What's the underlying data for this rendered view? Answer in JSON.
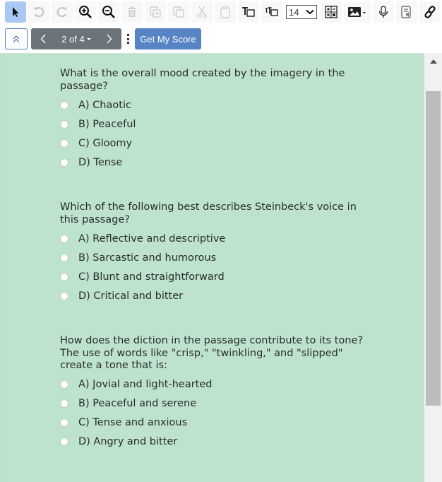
{
  "toolbar": {
    "items": [
      {
        "icon": "pointer-icon",
        "active": true,
        "enabled": true
      },
      {
        "icon": "undo-icon",
        "enabled": false
      },
      {
        "icon": "redo-icon",
        "enabled": false
      },
      {
        "icon": "zoom-in-icon",
        "enabled": true
      },
      {
        "icon": "zoom-out-icon",
        "enabled": true
      },
      {
        "icon": "trash-icon",
        "enabled": false
      },
      {
        "icon": "paste-special-icon",
        "enabled": false
      },
      {
        "icon": "copy-icon",
        "enabled": false
      },
      {
        "icon": "cut-icon",
        "enabled": false
      },
      {
        "icon": "clipboard-icon",
        "enabled": false
      },
      {
        "icon": "text-box-icon",
        "enabled": true
      },
      {
        "icon": "text-size-icon",
        "enabled": true
      }
    ],
    "font_size": "14",
    "extra": [
      "calculator-icon",
      "image-icon",
      "microphone-icon",
      "text-to-speech-icon",
      "link-icon"
    ]
  },
  "nav": {
    "page_label": "2 of 4",
    "score_button": "Get My Score",
    "colors": {
      "pager": "#6c747b",
      "score": "#5684c4",
      "content_bg": "#bde3cd"
    }
  },
  "questions": [
    {
      "text": "What is the overall mood created by the imagery in the passage?",
      "options": [
        "A) Chaotic",
        "B) Peaceful",
        "C) Gloomy",
        "D) Tense"
      ]
    },
    {
      "text": "Which of the following best describes Steinbeck's voice in this passage?",
      "options": [
        "A) Reflective and descriptive",
        "B) Sarcastic and humorous",
        "C) Blunt and straightforward",
        "D) Critical and bitter"
      ]
    },
    {
      "text": "How does the diction in the passage contribute to its tone?",
      "subtext": "The use of words like \"crisp,\" \"twinkling,\" and \"slipped\" create a tone that is:",
      "options": [
        "A) Jovial and light-hearted",
        "B) Peaceful and serene",
        "C) Tense and anxious",
        "D) Angry and bitter"
      ]
    }
  ]
}
